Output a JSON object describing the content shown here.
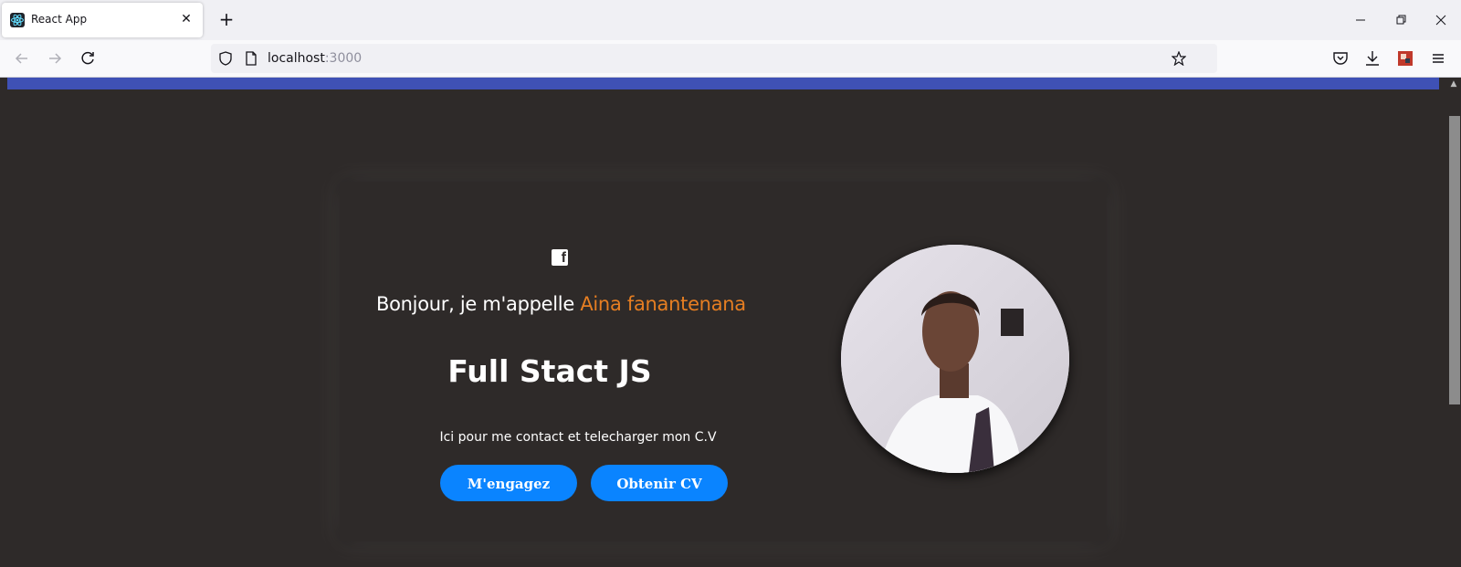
{
  "browser": {
    "tab_title": "React App",
    "tab_close": "✕",
    "new_tab": "+",
    "url_host": "localhost",
    "url_port": ":3000"
  },
  "hero": {
    "greeting_prefix": "Bonjour, je m'appelle ",
    "name": "Aina fanantenana",
    "role": "Full Stact JS",
    "tagline": "Ici pour me contact et telecharger mon C.V",
    "hire_button": "M'engagez",
    "cv_button": "Obtenir CV"
  },
  "colors": {
    "background": "#2e2a29",
    "topbar": "#3f51b5",
    "accent_name": "#e67e22",
    "button": "#0a84ff"
  },
  "icons": [
    "facebook-icon",
    "react-favicon",
    "shield-icon",
    "page-icon",
    "star-icon",
    "pocket-icon",
    "download-icon",
    "extension-icon",
    "menu-icon"
  ]
}
